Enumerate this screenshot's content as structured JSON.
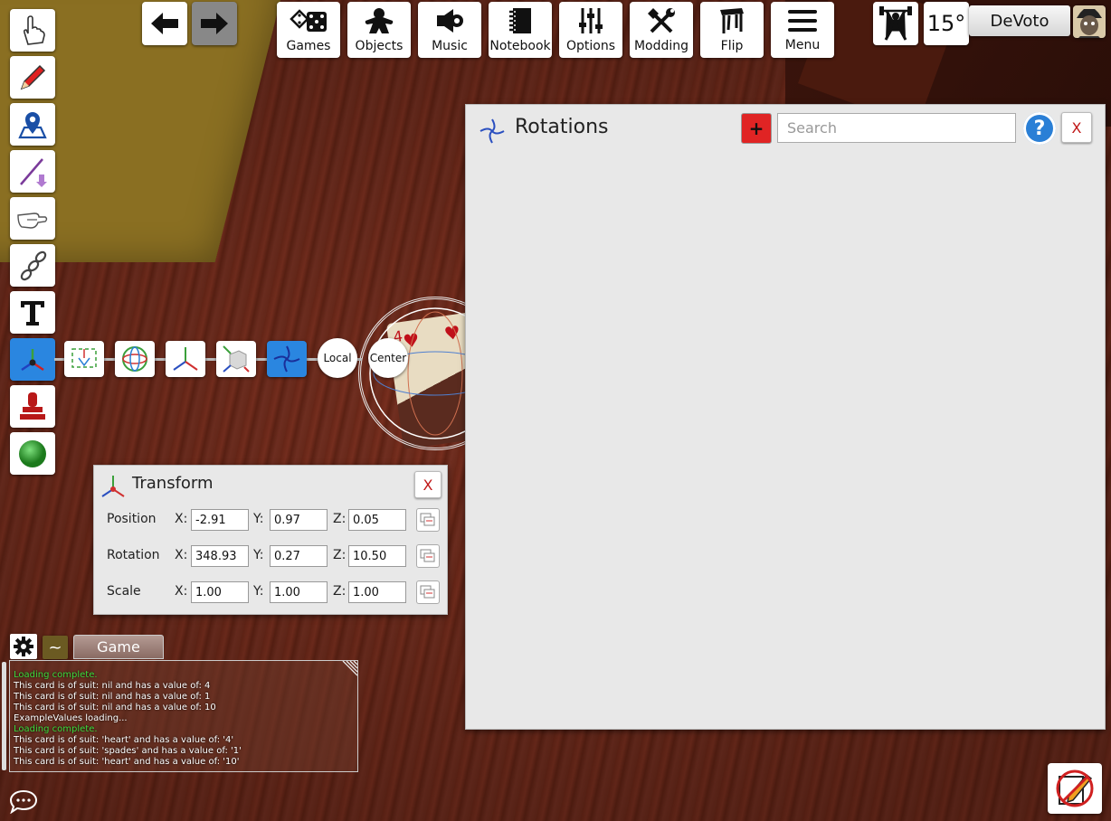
{
  "nav": {
    "back_icon": "arrow-left-icon",
    "forward_icon": "arrow-right-icon"
  },
  "menu": [
    {
      "label": "Games",
      "icon": "dice-icon"
    },
    {
      "label": "Objects",
      "icon": "meeple-icon"
    },
    {
      "label": "Music",
      "icon": "speaker-icon"
    },
    {
      "label": "Notebook",
      "icon": "notebook-icon"
    },
    {
      "label": "Options",
      "icon": "sliders-icon"
    },
    {
      "label": "Modding",
      "icon": "hammer-wrench-icon"
    },
    {
      "label": "Flip",
      "icon": "table-icon"
    },
    {
      "label": "Menu",
      "icon": "hamburger-icon"
    }
  ],
  "player": {
    "fov": "15°",
    "name": "DeVoto",
    "accent": "#ffffff"
  },
  "tools": [
    "pointer-icon",
    "pencil-icon",
    "map-pin-icon",
    "line-tool-icon",
    "flick-icon",
    "joint-icon",
    "text-tool-icon",
    "gizmo-icon",
    "stamp-icon",
    "color-ball-icon"
  ],
  "gizmo_bar": {
    "local_label": "Local",
    "center_label": "Center"
  },
  "rotations_panel": {
    "title": "Rotations",
    "add_label": "+",
    "search_placeholder": "Search",
    "help_label": "?",
    "close_label": "X"
  },
  "transform_panel": {
    "title": "Transform",
    "close_label": "X",
    "rows": [
      {
        "label": "Position",
        "x": "-2.91",
        "y": "0.97",
        "z": "0.05"
      },
      {
        "label": "Rotation",
        "x": "348.93",
        "y": "0.27",
        "z": "10.50"
      },
      {
        "label": "Scale",
        "x": "1.00",
        "y": "1.00",
        "z": "1.00"
      }
    ],
    "axis_labels": {
      "x": "X:",
      "y": "Y:",
      "z": "Z:"
    }
  },
  "chat": {
    "tilde_label": "~",
    "tab_label": "Game",
    "lines": [
      {
        "text": "Loading complete.",
        "ok": true
      },
      {
        "text": "This card is of suit: nil and has a value of: 4",
        "ok": false
      },
      {
        "text": "This card is of suit: nil and has a value of: 1",
        "ok": false
      },
      {
        "text": "This card is of suit: nil and has a value of: 10",
        "ok": false
      },
      {
        "text": "ExampleValues loading...",
        "ok": false
      },
      {
        "text": "Loading complete.",
        "ok": true
      },
      {
        "text": "This card is of suit: 'heart' and has a value of: '4'",
        "ok": false
      },
      {
        "text": "This card is of suit: 'spades' and has a value of: '1'",
        "ok": false
      },
      {
        "text": "This card is of suit: 'heart' and has a value of: '10'",
        "ok": false
      }
    ],
    "ok_color": "#3ddc3d"
  },
  "card": {
    "rank": "4",
    "suit_glyph": "♥"
  }
}
